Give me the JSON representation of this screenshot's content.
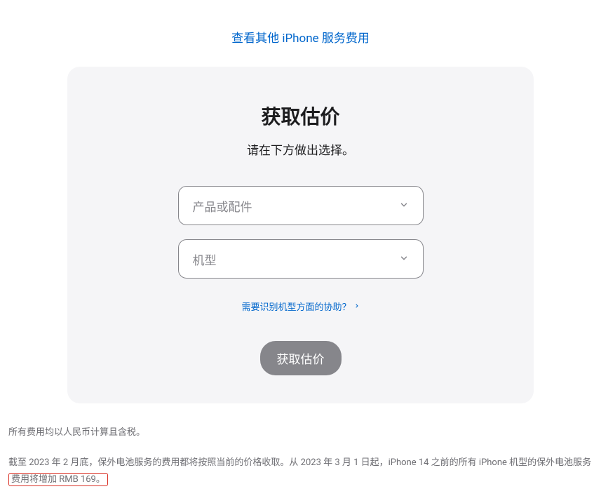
{
  "header": {
    "top_link": "查看其他 iPhone 服务费用"
  },
  "card": {
    "title": "获取估价",
    "subtitle": "请在下方做出选择。",
    "select_product_placeholder": "产品或配件",
    "select_model_placeholder": "机型",
    "help_link": "需要识别机型方面的协助？",
    "button": "获取估价"
  },
  "footer": {
    "line1": "所有费用均以人民币计算且含税。",
    "line2_part1": "截至 2023 年 2 月底，保外电池服务的费用都将按照当前的价格收取。从 2023 年 3 月 1 日起，iPhone 14 之前的所有 iPhone 机型的保外电池服务",
    "line2_highlight": "费用将增加 RMB 169。"
  }
}
